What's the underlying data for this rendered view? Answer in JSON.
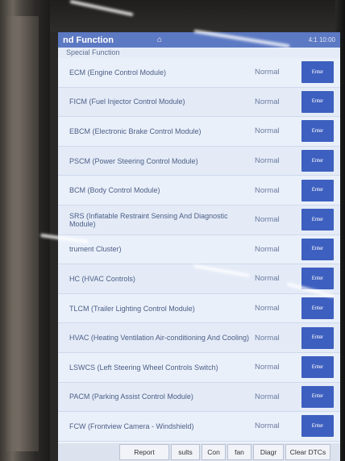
{
  "title_bar": {
    "title": "nd Function",
    "home_icon": "home-icon",
    "status": "4:1 10:00"
  },
  "breadcrumb": "Special Function",
  "modules": [
    {
      "name": "ECM (Engine Control Module)",
      "status": "Normal",
      "button": "Enter"
    },
    {
      "name": "FICM (Fuel Injector Control Module)",
      "status": "Normal",
      "button": "Enter"
    },
    {
      "name": "EBCM (Electronic Brake Control Module)",
      "status": "Normal",
      "button": "Enter"
    },
    {
      "name": "PSCM (Power Steering Control Module)",
      "status": "Normal",
      "button": "Enter"
    },
    {
      "name": "BCM (Body Control Module)",
      "status": "Normal",
      "button": "Enter"
    },
    {
      "name": "SRS (Inflatable Restraint Sensing And Diagnostic Module)",
      "status": "Normal",
      "button": "Enter"
    },
    {
      "name": "trument Cluster)",
      "status": "Normal",
      "button": "Enter"
    },
    {
      "name": "HC (HVAC Controls)",
      "status": "Normal",
      "button": "Enter"
    },
    {
      "name": "TLCM (Trailer Lighting Control Module)",
      "status": "Normal",
      "button": "Enter"
    },
    {
      "name": "HVAC (Heating Ventilation Air-conditioning And Cooling)",
      "status": "Normal",
      "button": "Enter"
    },
    {
      "name": "LSWCS (Left Steering Wheel Controls Switch)",
      "status": "Normal",
      "button": "Enter"
    },
    {
      "name": "PACM (Parking Assist Control Module)",
      "status": "Normal",
      "button": "Enter"
    },
    {
      "name": "FCW (Frontview Camera - Windshield)",
      "status": "Normal",
      "button": "Enter"
    }
  ],
  "toolbar": {
    "report": "Report",
    "results": "sults",
    "con": "Con",
    "fan": "fan",
    "diagr": "Diagr",
    "clear_dtcs": "Clear DTCs"
  },
  "colors": {
    "title_bar": "#5c79c3",
    "enter_button": "#3d5fbf",
    "row_bg": "#eaf0fa"
  }
}
